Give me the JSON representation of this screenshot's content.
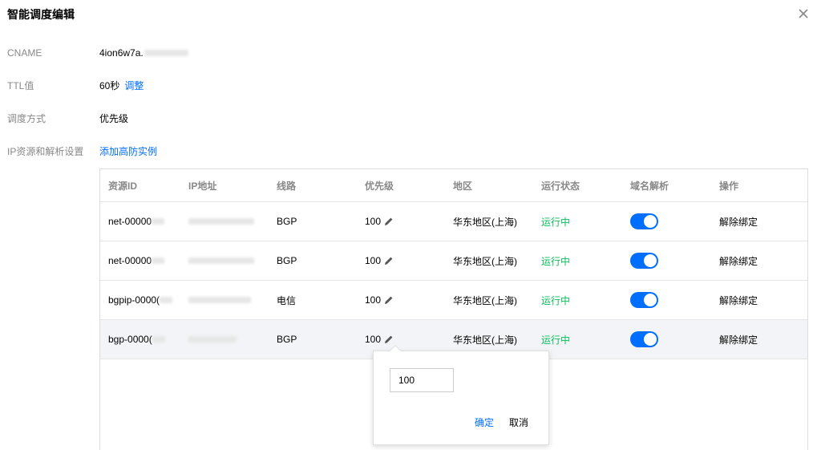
{
  "dialog": {
    "title": "智能调度编辑"
  },
  "form": {
    "cname": {
      "label": "CNAME",
      "value": "4ion6w7a."
    },
    "ttl": {
      "label": "TTL值",
      "value": "60秒",
      "action": "调整"
    },
    "schedule": {
      "label": "调度方式",
      "value": "优先级"
    },
    "ip_settings": {
      "label": "IP资源和解析设置",
      "action": "添加高防实例"
    }
  },
  "table": {
    "headers": [
      "资源ID",
      "IP地址",
      "线路",
      "优先级",
      "地区",
      "运行状态",
      "域名解析",
      "操作"
    ],
    "rows": [
      {
        "id": "net-00000",
        "ip": "",
        "line": "BGP",
        "priority": "100",
        "region": "华东地区(上海)",
        "status": "运行中",
        "dns": true,
        "action": "解除绑定"
      },
      {
        "id": "net-00000",
        "ip": "",
        "line": "BGP",
        "priority": "100",
        "region": "华东地区(上海)",
        "status": "运行中",
        "dns": true,
        "action": "解除绑定"
      },
      {
        "id": "bgpip-0000(",
        "ip": "",
        "line": "电信",
        "priority": "100",
        "region": "华东地区(上海)",
        "status": "运行中",
        "dns": true,
        "action": "解除绑定"
      },
      {
        "id": "bgp-0000(",
        "ip": "",
        "line": "BGP",
        "priority": "100",
        "region": "华东地区(上海)",
        "status": "运行中",
        "dns": true,
        "action": "解除绑定"
      }
    ]
  },
  "popover": {
    "value": "100",
    "confirm": "确定",
    "cancel": "取消"
  },
  "colors": {
    "link": "#006eff",
    "status_ok": "#0abf5b",
    "toggle_on": "#006eff",
    "row_hover": "#f3f4f7"
  }
}
